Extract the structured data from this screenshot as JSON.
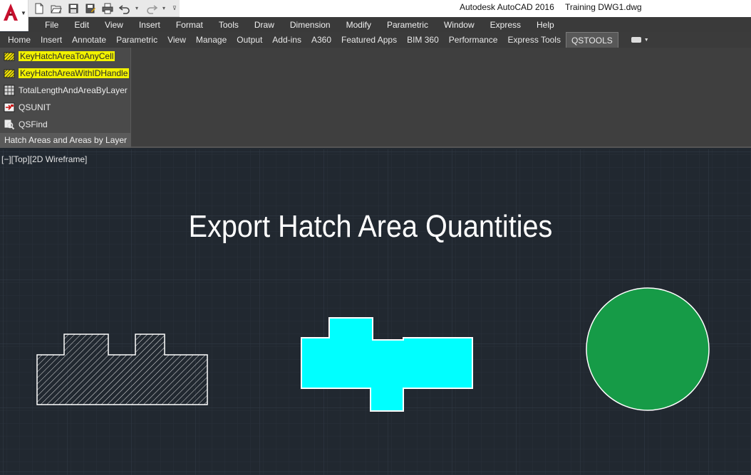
{
  "title_bar": {
    "app_name": "Autodesk AutoCAD 2016",
    "document": "Training DWG1.dwg"
  },
  "quick_access": {
    "icons": [
      "new-icon",
      "open-icon",
      "save-icon",
      "save-as-icon",
      "plot-icon",
      "undo-icon",
      "redo-icon"
    ]
  },
  "menu": {
    "items": [
      "File",
      "Edit",
      "View",
      "Insert",
      "Format",
      "Tools",
      "Draw",
      "Dimension",
      "Modify",
      "Parametric",
      "Window",
      "Express",
      "Help"
    ]
  },
  "ribbon_tabs": {
    "items": [
      "Home",
      "Insert",
      "Annotate",
      "Parametric",
      "View",
      "Manage",
      "Output",
      "Add-ins",
      "A360",
      "Featured Apps",
      "BIM 360",
      "Performance",
      "Express Tools",
      "QSTOOLS"
    ],
    "active": "QSTOOLS"
  },
  "panel": {
    "title": "Hatch Areas and Areas by Layer",
    "items": [
      {
        "label": "KeyHatchAreaToAnyCell",
        "icon": "hatch-key-icon",
        "highlighted": true
      },
      {
        "label": "KeyHatchAreaWithIDHandle",
        "icon": "hatch-key-icon",
        "highlighted": true
      },
      {
        "label": "TotalLengthAndAreaByLayer",
        "icon": "table-grid-icon",
        "highlighted": false
      },
      {
        "label": "QSUNIT",
        "icon": "unit-icon",
        "highlighted": false
      },
      {
        "label": "QSFind",
        "icon": "find-icon",
        "highlighted": false
      }
    ]
  },
  "viewport": {
    "label": "[−][Top][2D Wireframe]"
  },
  "drawing": {
    "title": "Export Hatch Area Quantities",
    "colors": {
      "background": "#212830",
      "hatch_stroke": "#e8e8e8",
      "cyan_fill": "#00ffff",
      "circle_fill": "#169b47",
      "outline": "#ffffff"
    }
  }
}
